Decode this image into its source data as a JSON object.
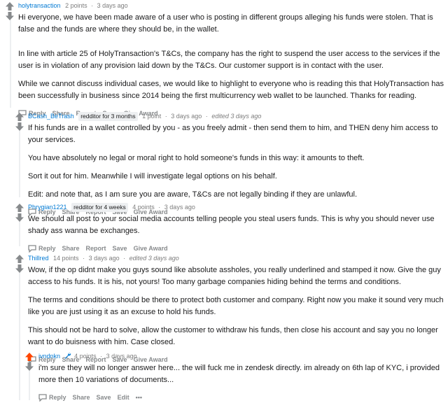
{
  "colors": {
    "upvote": "#ff4500",
    "downvote": "#7193ff",
    "link": "#0079d3",
    "muted": "#878a8c"
  },
  "actions": {
    "reply": "Reply",
    "share": "Share",
    "report": "Report",
    "save": "Save",
    "give_award": "Give Award",
    "edit": "Edit",
    "more": "•••"
  },
  "comments": [
    {
      "author": "holytransaction",
      "points": "2 points",
      "time": "3 days ago",
      "vote_state": "none",
      "paragraphs": [
        "Hi everyone, we have been made aware of a user who is posting in different groups alleging his funds were stolen. That is false and the funds are where they should be, in the wallet.",
        "In line with article 25 of HolyTransaction's T&Cs, the company has the right to suspend the user access to the services if the user is in violation of any provision laid down by the T&Cs. Our customer support is in contact with the user.",
        "While we cannot discuss individual cases, we would like to highlight to everyone who is reading this that HolyTransaction has been successfully in business since 2014 being the first multicurrency web wallet to be launched. Thanks for reading."
      ]
    },
    {
      "author": "BCash_BeTrash",
      "flair": "redditor for 3 months",
      "points": "1 point",
      "time": "3 days ago",
      "edited": "edited 3 days ago",
      "vote_state": "none",
      "paragraphs": [
        "If his funds are in a wallet controlled by you - as you freely admit - then send them to him, and THEN deny him access to your services.",
        "You have absolutely no legal or moral right to hold someone's funds in this way: it amounts to theft.",
        "Sort it out for him. Meanwhile I will investigate legal options on his behalf.",
        "Edit: and note that, as I am sure you are aware, T&Cs are not legally binding if they are unlawful."
      ]
    },
    {
      "author": "Phrygian1221",
      "flair": "redditor for 4 weeks",
      "points": "4 points",
      "time": "3 days ago",
      "vote_state": "none",
      "paragraphs": [
        "We should all post to your social media accounts telling people you steal users funds. This is why you should never use shady ass wanna be exchanges."
      ]
    },
    {
      "author": "Thillred",
      "points": "14 points",
      "time": "3 days ago",
      "edited": "edited 3 days ago",
      "vote_state": "none",
      "paragraphs": [
        "Wow, if the op didnt make you guys sound like absolute assholes, you really underlined and stamped it now. Give the guy access to his funds. It is his, not yours! Too many garbage companies hiding behind the terms and conditions.",
        "The terms and conditions should be there to protect both customer and company. Right now you make it sound very much like you are just using it as an excuse to hold his funds.",
        "This should not be hard to solve, allow the customer to withdraw his funds, then close his account and say you no longer want to do buisness with him. Case closed."
      ]
    },
    {
      "author": "ivndnkn",
      "points": "4 points",
      "time": "3 days ago",
      "vote_state": "up",
      "paragraphs": [
        "i'm sure they will no longer answer here... the will fuck me in zendesk directly. im already on 6th lap of KYC, i provided more then 10 variations of documents..."
      ]
    }
  ]
}
